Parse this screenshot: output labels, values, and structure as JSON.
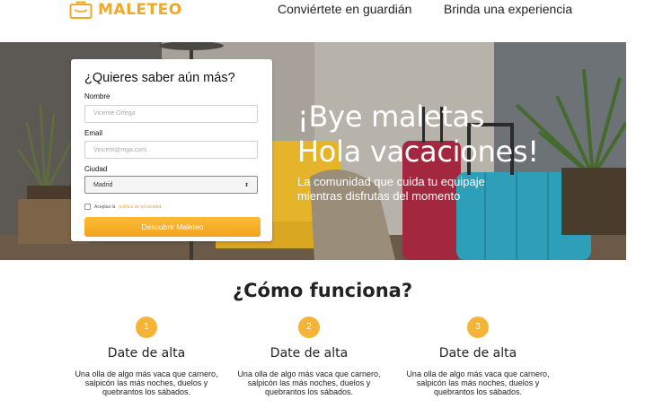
{
  "header": {
    "logo_text": "MALETEO",
    "nav": [
      "Conviértete en guardián",
      "Brinda una experiencia"
    ]
  },
  "hero": {
    "headline_line1": "¡Bye maletas",
    "headline_line2": "Hola vacaciones!",
    "subtitle": "La comunidad que cuida tu equipaje mientras disfrutas del momento"
  },
  "form": {
    "title": "¿Quieres saber aún más?",
    "name_label": "Nombre",
    "name_placeholder": "Vicente Ortega",
    "email_label": "Email",
    "email_placeholder": "Vincent@mga.com",
    "city_label": "Ciudad",
    "city_selected": "Madrid",
    "terms_prefix": "Aceptas la",
    "terms_link": "política de privacidad",
    "submit_label": "Descubrir Maleteo"
  },
  "how": {
    "title": "¿Cómo funciona?",
    "steps": [
      {
        "num": "1",
        "title": "Date de alta",
        "text": "Una olla de algo más vaca que carnero, salpicón las más noches, duelos y quebrantos los sábados."
      },
      {
        "num": "2",
        "title": "Date de alta",
        "text": "Una olla de algo más vaca que carnero, salpicón las más noches, duelos y quebrantos los sábados."
      },
      {
        "num": "3",
        "title": "Date de alta",
        "text": "Una olla de algo más vaca que carnero, salpicón las más noches, duelos y quebrantos los sábados."
      }
    ]
  },
  "colors": {
    "accent": "#f3a824",
    "button_top": "#fbbd35",
    "button_bottom": "#f2a21f",
    "suitcase_blue": "#2e9fb8",
    "suitcase_red": "#a3283f"
  }
}
